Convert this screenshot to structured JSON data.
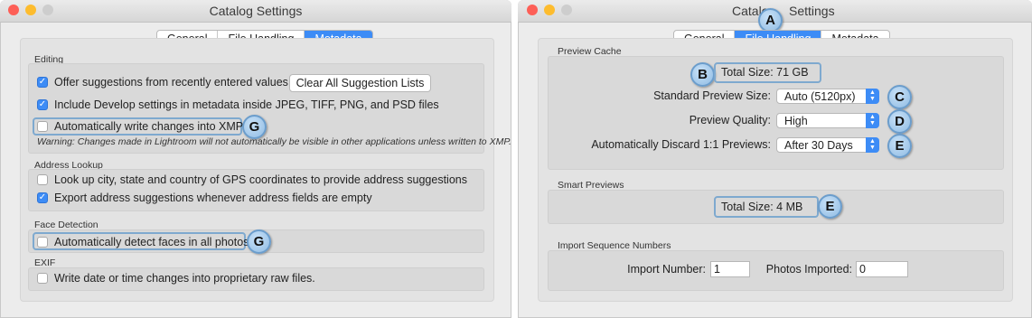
{
  "colors": {
    "accent": "#3d8cf6",
    "close": "#fd5f57",
    "minimize": "#fdbc2e",
    "inactive": "#cdcdcd",
    "annotation": "#7ea9cf"
  },
  "left": {
    "title": "Catalog Settings",
    "tabs": [
      {
        "label": "General"
      },
      {
        "label": "File Handling"
      },
      {
        "label": "Metadata",
        "active": true
      }
    ],
    "editing": {
      "title": "Editing",
      "offer_suggestions": {
        "label": "Offer suggestions from recently entered values",
        "checked": true
      },
      "clear_button": "Clear All Suggestion Lists",
      "include_develop": {
        "label": "Include Develop settings in metadata inside JPEG, TIFF, PNG, and PSD files",
        "checked": true
      },
      "write_xmp": {
        "label": "Automatically write changes into XMP",
        "checked": false
      },
      "warning": "Warning: Changes made in Lightroom will not automatically be visible in other applications unless written to XMP."
    },
    "address": {
      "title": "Address Lookup",
      "lookup": {
        "label": "Look up city, state and country of GPS coordinates to provide address suggestions",
        "checked": false
      },
      "export": {
        "label": "Export address suggestions whenever address fields are empty",
        "checked": true
      }
    },
    "faces": {
      "title": "Face Detection",
      "detect": {
        "label": "Automatically detect faces in all photos",
        "checked": false
      }
    },
    "exif": {
      "title": "EXIF",
      "write_date": {
        "label": "Write date or time changes into proprietary raw files.",
        "checked": false
      }
    },
    "badges": {
      "xmp": "G",
      "faces": "G"
    }
  },
  "right": {
    "title_part1": "Catalo",
    "title_part2": "Settings",
    "tabs": [
      {
        "label": "General"
      },
      {
        "label": "File Handling",
        "active": true
      },
      {
        "label": "Metadata"
      }
    ],
    "preview_cache": {
      "title": "Preview Cache",
      "total_size": "Total Size:   71 GB",
      "standard_size_label": "Standard Preview Size:",
      "standard_size_value": "Auto (5120px)",
      "quality_label": "Preview Quality:",
      "quality_value": "High",
      "discard_label": "Automatically Discard 1:1 Previews:",
      "discard_value": "After 30 Days"
    },
    "smart_previews": {
      "title": "Smart Previews",
      "total_size": "Total Size:   4 MB"
    },
    "import_seq": {
      "title": "Import Sequence Numbers",
      "import_number_label": "Import Number:",
      "import_number_value": "1",
      "photos_imported_label": "Photos Imported:",
      "photos_imported_value": "0"
    },
    "badges": {
      "tabs": "A",
      "cache_total": "B",
      "standard_size": "C",
      "quality": "D",
      "discard": "E",
      "smart_total": "E"
    }
  }
}
